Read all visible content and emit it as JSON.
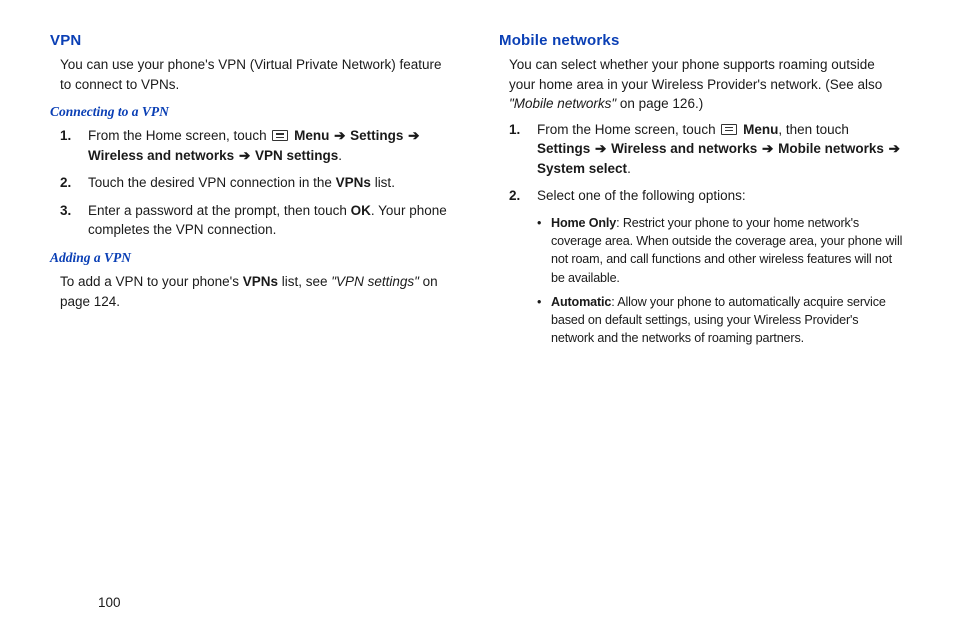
{
  "left": {
    "vpn_heading": "VPN",
    "vpn_intro": "You can use your phone's VPN (Virtual Private Network) feature to connect to VPNs.",
    "connecting_heading": "Connecting to a VPN",
    "connect_step1_pre": "From the Home screen, touch ",
    "connect_step1_menu": " Menu ",
    "connect_step1_mid1": " Settings ",
    "connect_step1_mid2": "Wireless and networks ",
    "connect_step1_end": " VPN settings",
    "connect_step2_pre": "Touch the desired VPN connection in the ",
    "connect_step2_bold": "VPNs",
    "connect_step2_post": " list.",
    "connect_step3_pre": "Enter a password at the prompt, then touch ",
    "connect_step3_bold": "OK",
    "connect_step3_post": ". Your phone completes the VPN connection.",
    "adding_heading": "Adding a VPN",
    "adding_pre": "To add a VPN to your phone's ",
    "adding_bold": "VPNs",
    "adding_mid": " list, see ",
    "adding_ital": "\"VPN settings\"",
    "adding_post": " on page 124."
  },
  "right": {
    "mn_heading": "Mobile networks",
    "mn_intro_pre": "You can select whether your phone supports roaming outside your home area in your Wireless Provider's network. (See also ",
    "mn_intro_ital": "\"Mobile networks\"",
    "mn_intro_post": " on page 126.)",
    "step1_pre": "From the Home screen, touch ",
    "step1_menu": " Menu",
    "step1_mid0": ", then touch ",
    "step1_b1": "Settings ",
    "step1_b2": " Wireless and networks ",
    "step1_b3": " Mobile networks ",
    "step1_b4": "System select",
    "step2": "Select one of the following options:",
    "opt1_head": "Home Only",
    "opt1_body": ": Restrict your phone to your home network's coverage area. When outside the coverage area, your phone will not roam, and call functions and other wireless features will not be available.",
    "opt2_head": "Automatic",
    "opt2_body_pre": ": Allow your phone to automatically acquire service based on default settings, using ",
    "opt2_body_mid": "your Wireless Provider's",
    "opt2_body_post": " network and the networks of roaming partners."
  },
  "pagenum": "100",
  "num1": "1.",
  "num2": "2.",
  "num3": "3.",
  "arrow": "➔",
  "bullet": "•",
  "period": "."
}
